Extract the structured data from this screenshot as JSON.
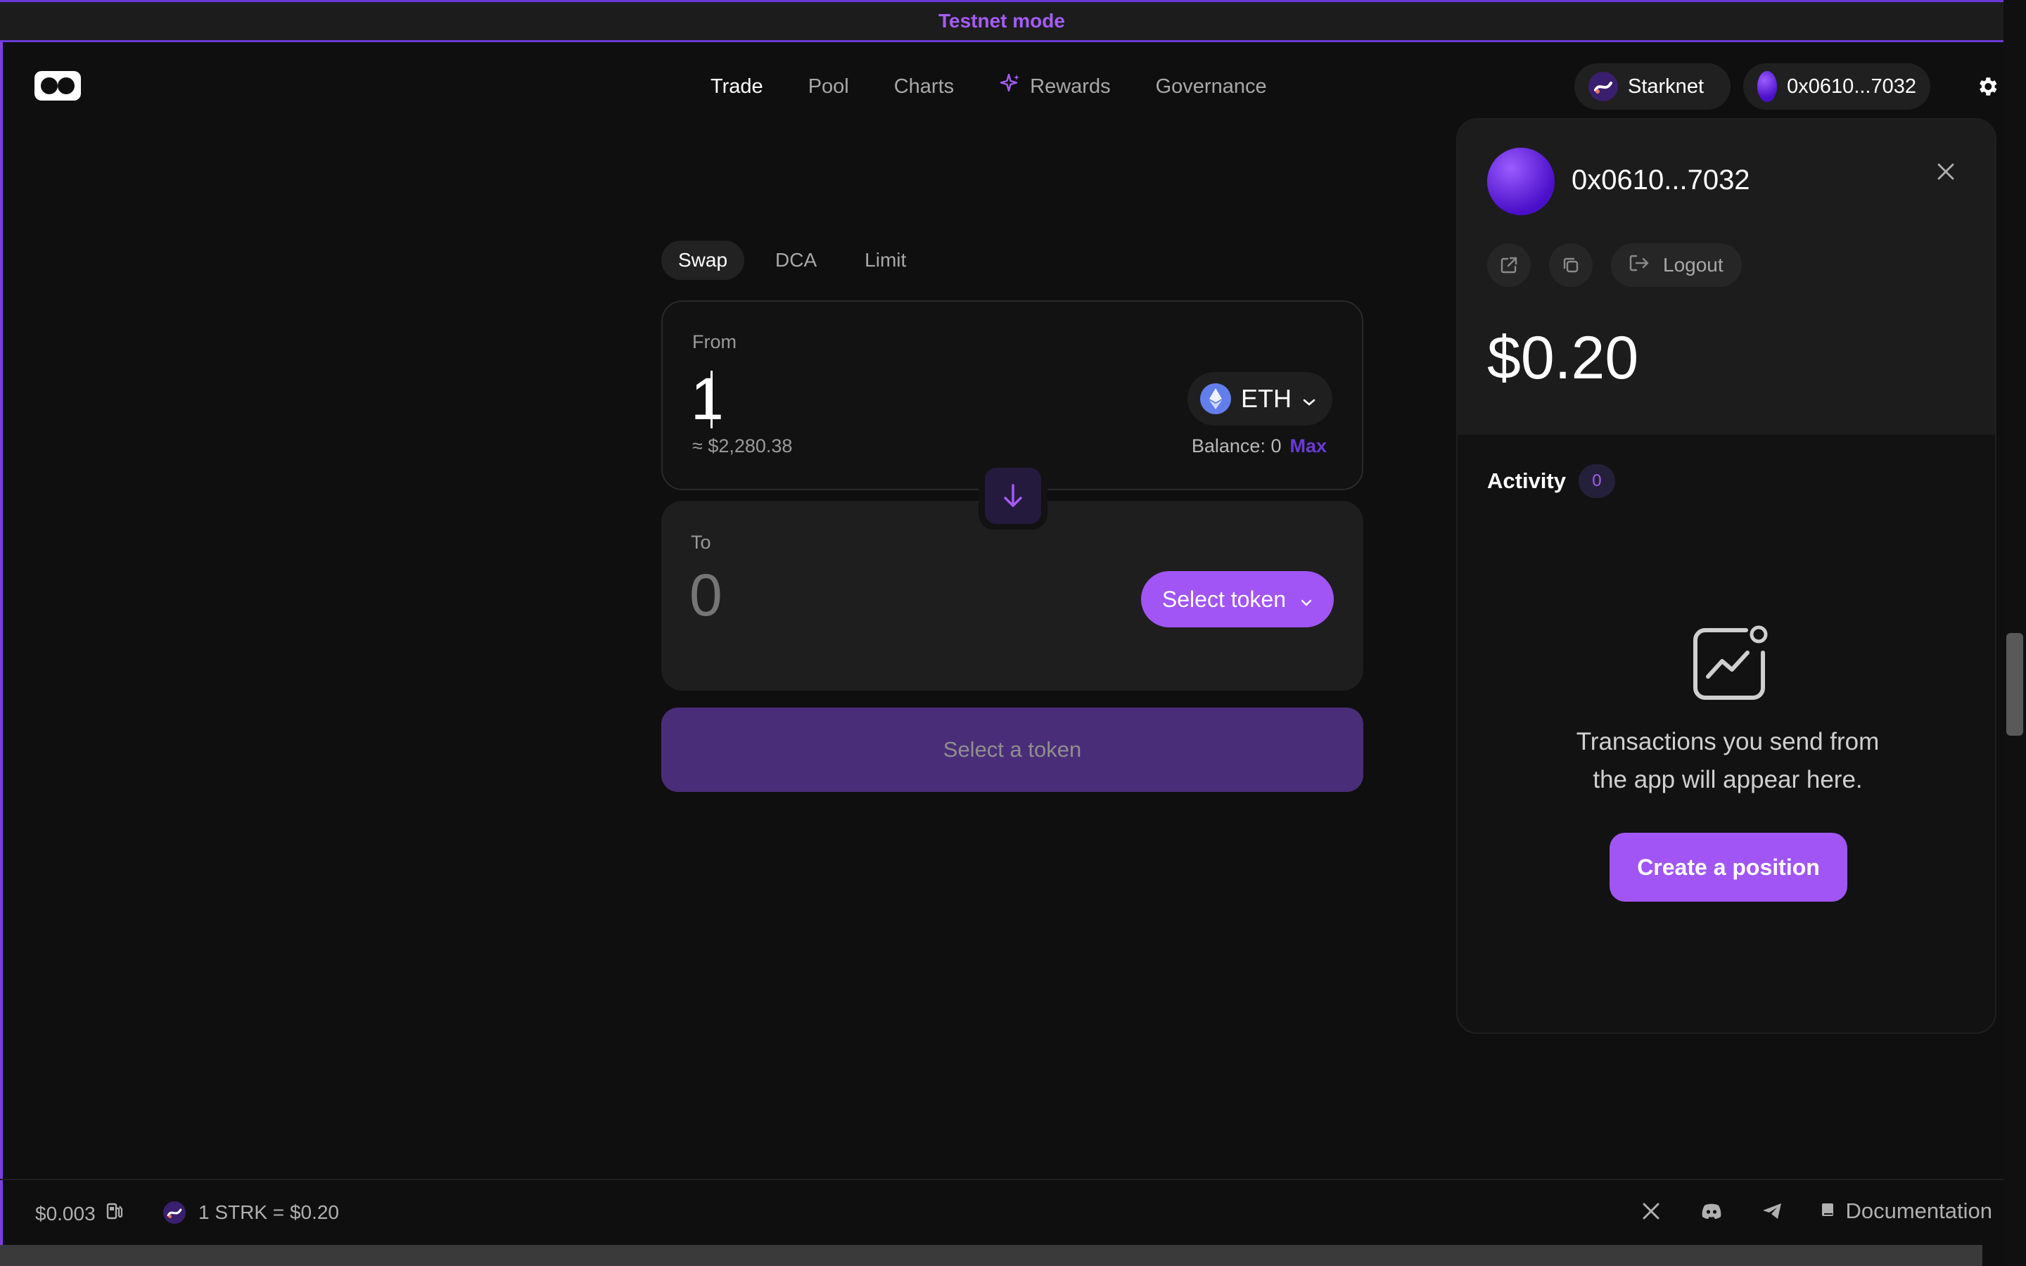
{
  "banner": {
    "text": "Testnet mode"
  },
  "header": {
    "nav": [
      {
        "label": "Trade",
        "active": true
      },
      {
        "label": "Pool"
      },
      {
        "label": "Charts"
      },
      {
        "label": "Rewards",
        "icon": "sparkle-icon"
      },
      {
        "label": "Governance"
      }
    ],
    "network_label": "Starknet",
    "account_label": "0x0610...7032"
  },
  "swap": {
    "tabs": [
      "Swap",
      "DCA",
      "Limit"
    ],
    "from": {
      "label": "From",
      "amount": "1",
      "usd_value": "≈ $2,280.38",
      "token": "ETH",
      "balance_label": "Balance: 0",
      "max_label": "Max"
    },
    "to": {
      "label": "To",
      "amount_placeholder": "0",
      "select_label": "Select token"
    },
    "cta_label": "Select a token"
  },
  "account_panel": {
    "address": "0x0610...7032",
    "logout_label": "Logout",
    "balance": "$0.20",
    "activity_label": "Activity",
    "activity_count": "0",
    "empty_line1": "Transactions you send from",
    "empty_line2": "the app will appear here.",
    "create_label": "Create a position"
  },
  "footer": {
    "gas_price": "$0.003",
    "strk_rate": "1 STRK = $0.20",
    "documentation_label": "Documentation"
  },
  "colors": {
    "accent": "#a155f5",
    "banner_text": "#a55cf6",
    "cta_bg": "#4a2d78",
    "background": "#0f0f0f"
  }
}
